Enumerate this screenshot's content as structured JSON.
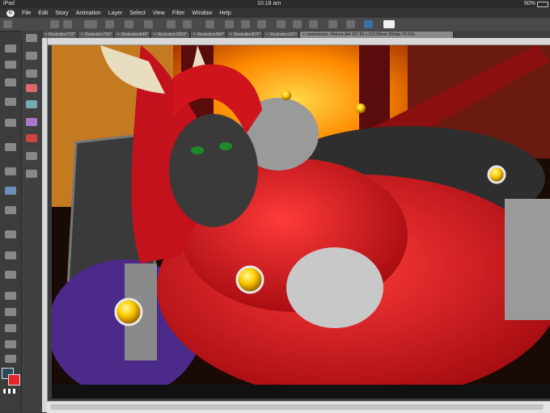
{
  "status_bar": {
    "device": "iPad",
    "time": "10:18 am",
    "battery": "60%"
  },
  "menu": {
    "logo": "C",
    "items": [
      "File",
      "Edit",
      "Story",
      "Animation",
      "Layer",
      "Select",
      "View",
      "Filter",
      "Window",
      "Help"
    ]
  },
  "tabs": [
    {
      "label": "Illustration732*"
    },
    {
      "label": "Illustration750*"
    },
    {
      "label": "Illustration940*"
    },
    {
      "label": "Illustration1003*"
    },
    {
      "label": "Illustration960*"
    },
    {
      "label": "Illustration876*"
    },
    {
      "label": "Illustration101*"
    },
    {
      "label": "commission- Helena (A4 297.00 x 210.00mm 300dpi 70.6%)"
    }
  ],
  "active_tab_index": 7,
  "colors": {
    "main": "#e8232a",
    "sub": "#2b4a5c",
    "accent": "#e8232a"
  }
}
